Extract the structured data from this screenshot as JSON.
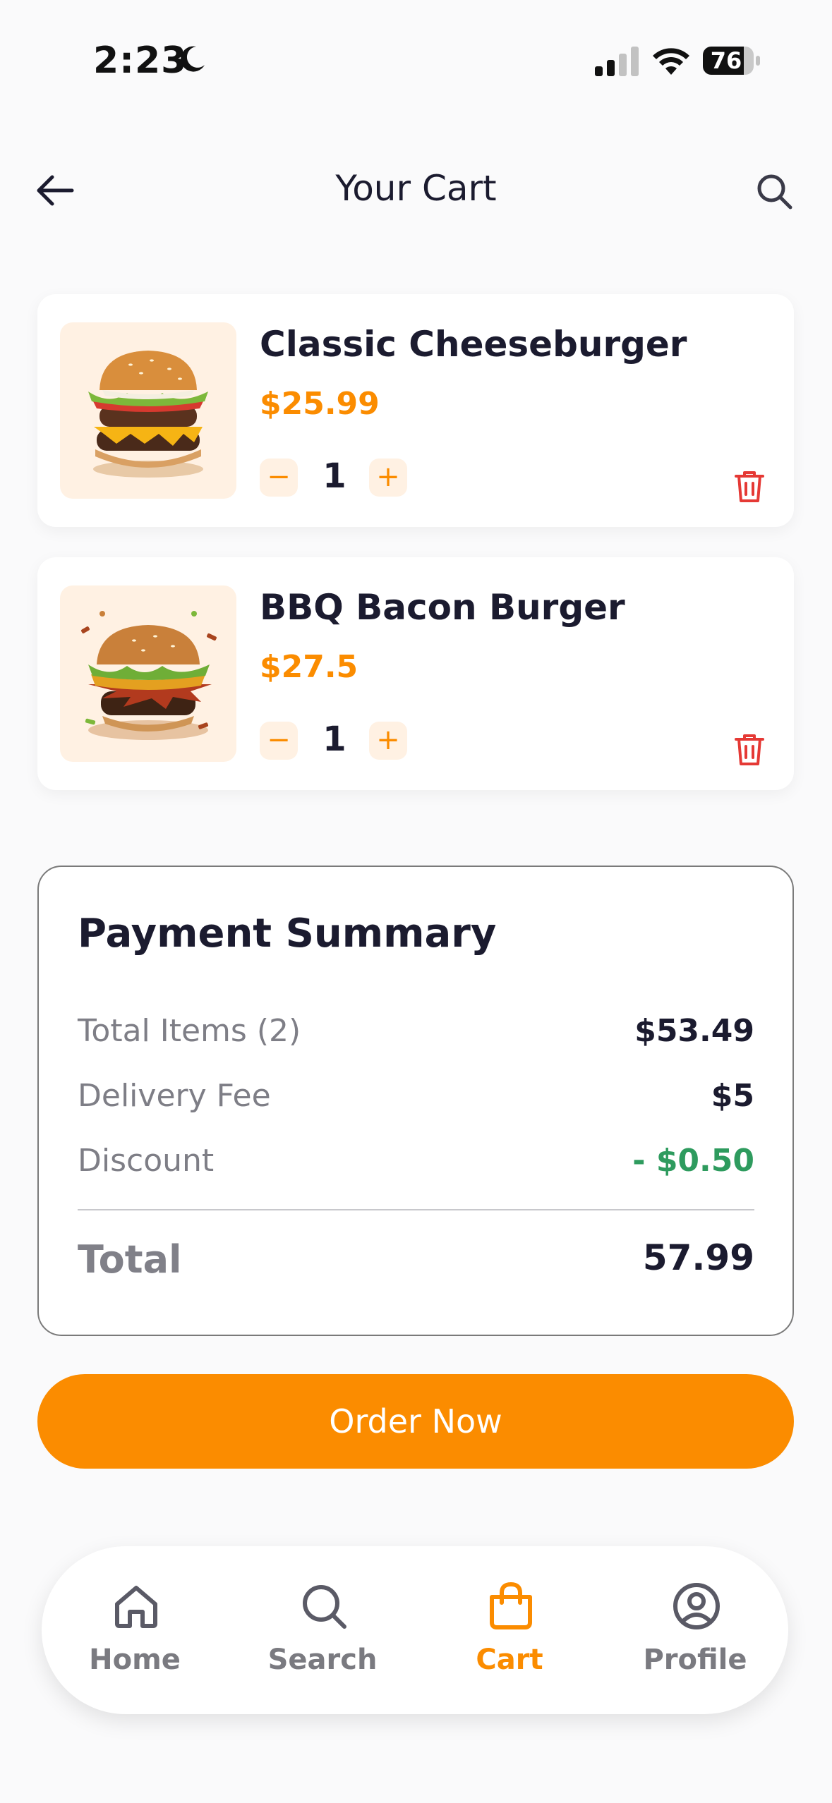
{
  "status_bar": {
    "time": "2:23",
    "battery": "76"
  },
  "header": {
    "title": "Your Cart"
  },
  "cart": {
    "items": [
      {
        "name": "Classic Cheeseburger",
        "price": "$25.99",
        "quantity": "1",
        "minus": "−",
        "plus": "+"
      },
      {
        "name": "BBQ Bacon Burger",
        "price": "$27.5",
        "quantity": "1",
        "minus": "−",
        "plus": "+"
      }
    ]
  },
  "summary": {
    "title": "Payment Summary",
    "rows": [
      {
        "label": "Total Items (2)",
        "value": "$53.49"
      },
      {
        "label": "Delivery Fee",
        "value": "$5"
      },
      {
        "label": "Discount",
        "value": "- $0.50"
      }
    ],
    "total_label": "Total",
    "total_value": "57.99"
  },
  "order_button": "Order Now",
  "nav": {
    "items": [
      {
        "label": "Home",
        "icon": "home-icon"
      },
      {
        "label": "Search",
        "icon": "search-icon"
      },
      {
        "label": "Cart",
        "icon": "bag-icon"
      },
      {
        "label": "Profile",
        "icon": "profile-icon"
      }
    ],
    "active": "Cart"
  },
  "colors": {
    "accent": "#FB8C00",
    "accent_light": "#FFF1E3",
    "discount": "#2E9B5E",
    "delete": "#E53935",
    "text_dark": "#1B1B2F",
    "text_muted": "#7E7E86"
  }
}
